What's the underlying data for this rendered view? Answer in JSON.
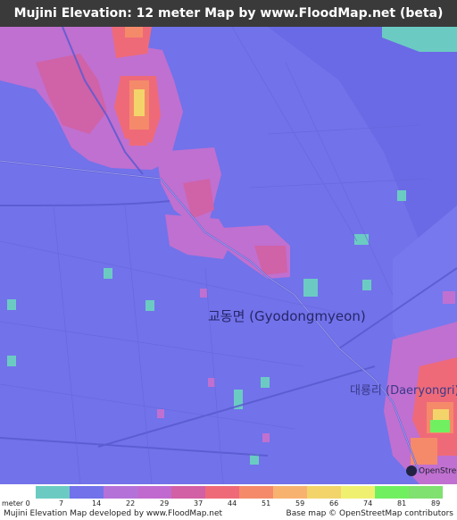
{
  "title": "Mujini Elevation: 12 meter Map by www.FloodMap.net (beta)",
  "map": {
    "place_main": "교동면 (Gyodongmyeon)",
    "place_minor": "대룡리 (Daeryongri)",
    "osm_logo_text": "OpenStreetMap"
  },
  "legend": {
    "unit_label": "meter 0",
    "ticks": [
      "7",
      "14",
      "22",
      "29",
      "37",
      "44",
      "51",
      "59",
      "66",
      "74",
      "81",
      "89"
    ],
    "colors": [
      "#6bcbc3",
      "#7272ea",
      "#b472d8",
      "#c06ad0",
      "#d260a4",
      "#ef6a78",
      "#f58a6a",
      "#f8b270",
      "#f3d46a",
      "#f0f070",
      "#70f060",
      "#80e070"
    ]
  },
  "credits": {
    "left": "Mujini Elevation Map developed by www.FloodMap.net",
    "right": "Base map © OpenStreetMap contributors"
  }
}
